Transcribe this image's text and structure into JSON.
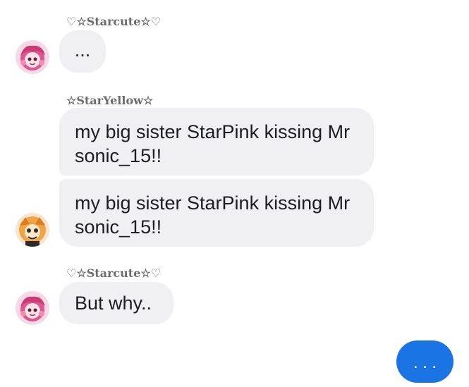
{
  "messages": [
    {
      "sender": "♡☆Starcute☆♡",
      "text": "..."
    },
    {
      "sender": "☆StarYellow☆",
      "text_1": "my big sister StarPink kissing Mr sonic_15!!",
      "text_2": "my big sister StarPink kissing Mr sonic_15!!"
    },
    {
      "sender": "♡☆Starcute☆♡",
      "text": "But why.."
    }
  ],
  "outgoing_typing": "...",
  "icons": {
    "avatar_starcute": "pink-haired-character-avatar",
    "avatar_staryellow": "orange-character-avatar"
  },
  "colors": {
    "incoming_bubble": "#f0f0f3",
    "outgoing_bubble": "#1b74e4",
    "sender_text": "#6b6b6b"
  }
}
